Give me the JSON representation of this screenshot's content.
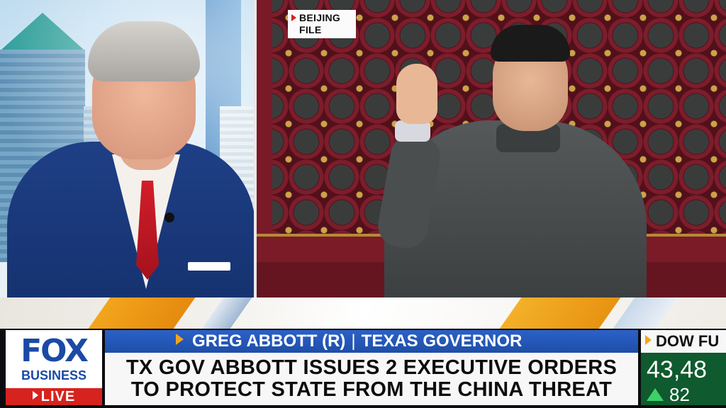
{
  "video": {
    "left_feed": "guest-interview",
    "right_feed": "file-footage",
    "file_tag": {
      "line1": "BEIJING",
      "line2": "FILE"
    }
  },
  "network": {
    "logo_main": "FOX",
    "logo_sub": "BUSINESS",
    "live_label": "LIVE"
  },
  "lower_third": {
    "name": "GREG ABBOTT (R)",
    "separator": "|",
    "title": "TEXAS GOVERNOR",
    "headline_line1": "TX GOV ABBOTT ISSUES 2 EXECUTIVE ORDERS",
    "headline_line2": "TO PROTECT STATE FROM THE CHINA THREAT"
  },
  "ticker": {
    "label": "DOW FU",
    "value": "43,48",
    "change": "82",
    "direction": "up"
  },
  "colors": {
    "fox_blue": "#1a4aa6",
    "live_red": "#d6231e",
    "accent_orange": "#f2a51c",
    "name_bar_blue": "#2b61c8",
    "ticker_green": "#0f5a2e"
  }
}
